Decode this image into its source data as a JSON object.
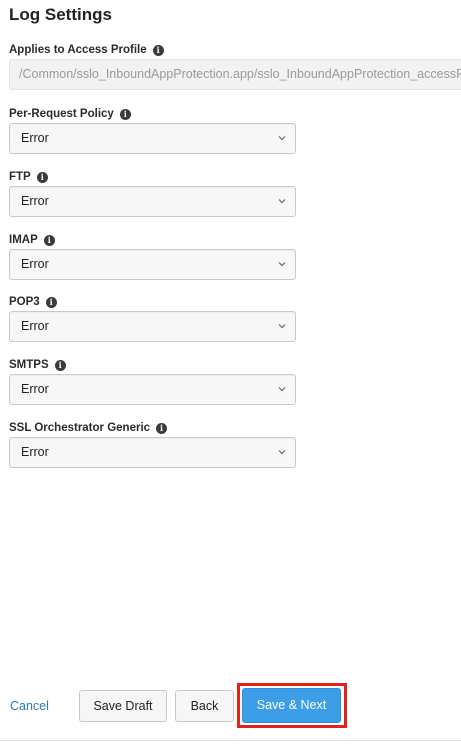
{
  "header": {
    "title": "Log Settings"
  },
  "access_profile": {
    "label": "Applies to Access Profile",
    "value": "/Common/sslo_InboundAppProtection.app/sslo_InboundAppProtection_accessProfile"
  },
  "fields": [
    {
      "label": "Per-Request Policy",
      "value": "Error"
    },
    {
      "label": "FTP",
      "value": "Error"
    },
    {
      "label": "IMAP",
      "value": "Error"
    },
    {
      "label": "POP3",
      "value": "Error"
    },
    {
      "label": "SMTPS",
      "value": "Error"
    },
    {
      "label": "SSL Orchestrator Generic",
      "value": "Error"
    }
  ],
  "footer": {
    "cancel_label": "Cancel",
    "save_draft_label": "Save Draft",
    "back_label": "Back",
    "save_next_label": "Save & Next"
  },
  "icons": {
    "info": "info-icon",
    "dropdown": "chevron-down-icon"
  },
  "colors": {
    "primary_button": "#3d9ee8",
    "link": "#2a7ab8",
    "highlight": "#e2231a"
  }
}
